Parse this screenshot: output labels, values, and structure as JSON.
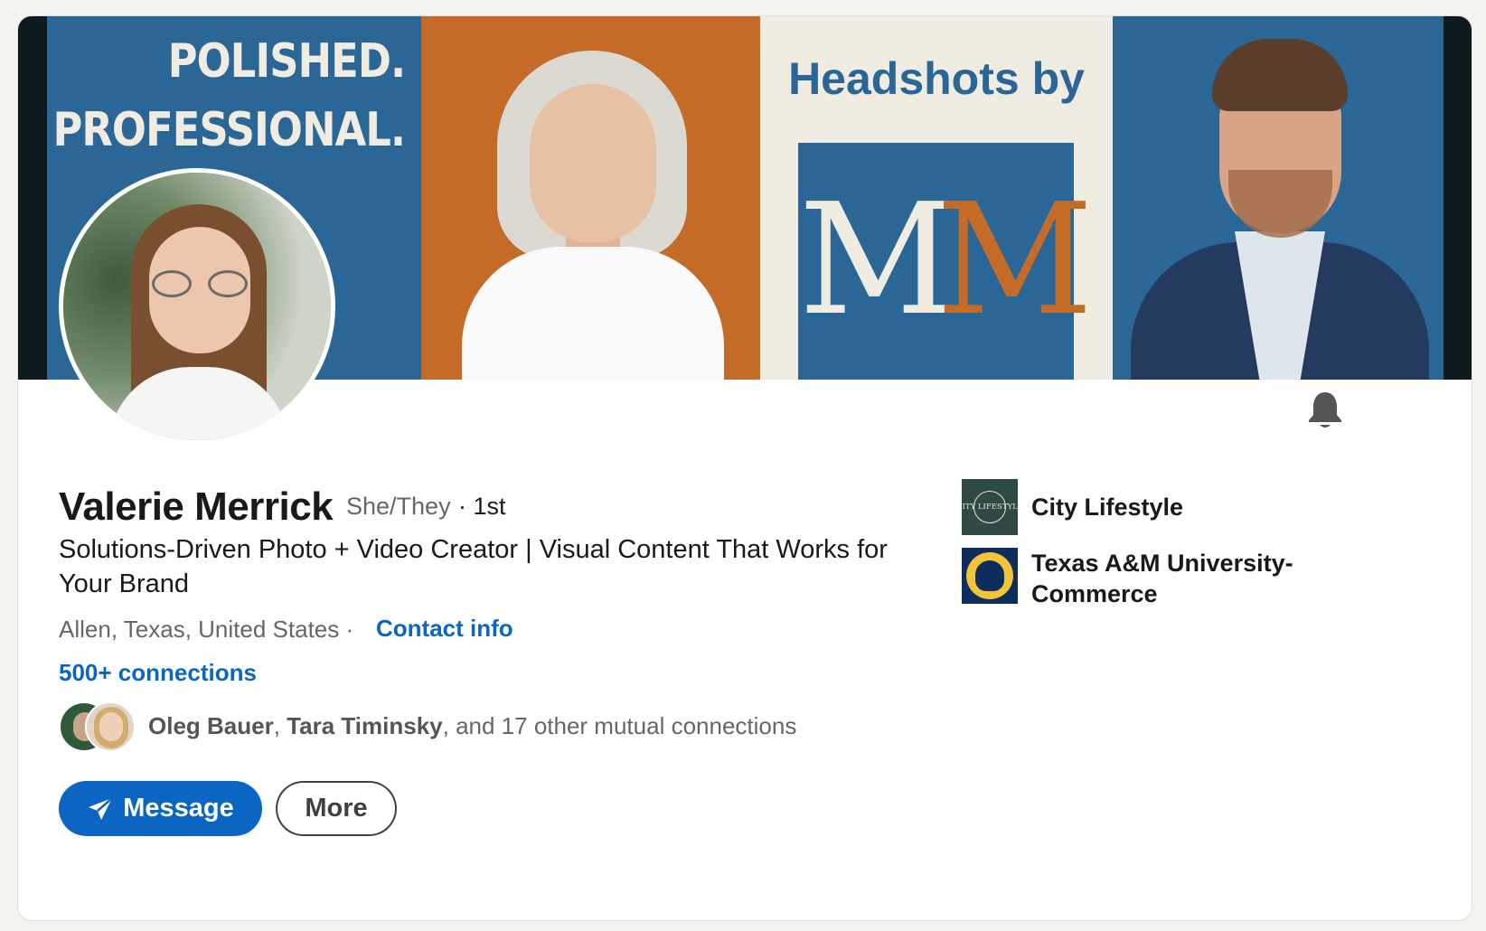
{
  "banner": {
    "tagline_line1": "POLISHED.",
    "tagline_line2": "PROFESSIONAL.",
    "headshots_text": "Headshots by",
    "logo_letters": [
      "M",
      "M"
    ],
    "colors": {
      "blue": "#2a6796",
      "orange": "#c36b27",
      "cream": "#f1ece1"
    }
  },
  "profile": {
    "name": "Valerie Merrick",
    "pronouns": "She/They",
    "degree": "· 1st",
    "headline": "Solutions-Driven Photo + Video Creator | Visual Content That Works for Your Brand",
    "location": "Allen, Texas, United States ·",
    "contact_info": "Contact info",
    "connections": "500+ connections"
  },
  "mutual": {
    "person1": "Oleg Bauer",
    "separator": ", ",
    "person2": "Tara Timinsky",
    "suffix": ", and 17 other mutual connections"
  },
  "actions": {
    "message_label": "Message",
    "more_label": "More"
  },
  "organizations": [
    {
      "name": "City Lifestyle",
      "logo_text": "CITY LIFESTYLE"
    },
    {
      "name": "Texas A&M University-Commerce"
    }
  ],
  "icons": {
    "bell": "bell-icon",
    "send": "paper-plane-icon"
  },
  "accent_color": "#0a66c2"
}
